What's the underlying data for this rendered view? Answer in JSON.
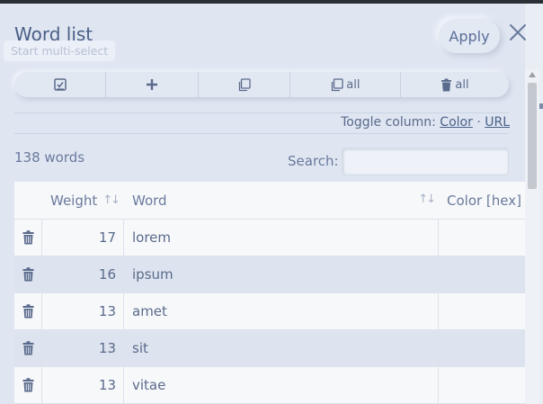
{
  "dialog": {
    "title": "Word list",
    "multi_select_hint": "Start multi-select",
    "apply_label": "Apply"
  },
  "toolbar": {
    "buttons": [
      {
        "icon": "select-all-checkbox-icon",
        "label": ""
      },
      {
        "icon": "plus-icon",
        "label": ""
      },
      {
        "icon": "copy-icon",
        "label": ""
      },
      {
        "icon": "copy-icon",
        "label": "all"
      },
      {
        "icon": "trash-icon",
        "label": "all"
      }
    ]
  },
  "toggle_column": {
    "label": "Toggle column:",
    "separator": "·",
    "options": [
      "Color",
      "URL"
    ]
  },
  "summary": {
    "count_text": "138 words"
  },
  "search": {
    "label": "Search:",
    "value": ""
  },
  "table": {
    "columns": [
      "Weight",
      "Word",
      "Color [hex]"
    ],
    "rows": [
      {
        "weight": "17",
        "word": "lorem",
        "color": ""
      },
      {
        "weight": "16",
        "word": "ipsum",
        "color": ""
      },
      {
        "weight": "13",
        "word": "amet",
        "color": ""
      },
      {
        "weight": "13",
        "word": "sit",
        "color": ""
      },
      {
        "weight": "13",
        "word": "vitae",
        "color": ""
      }
    ]
  },
  "colors": {
    "background": "#dfe6f2",
    "text": "#5a6a8c",
    "row_alt": "#dde4ef",
    "row_plain": "#f7f8fa"
  }
}
